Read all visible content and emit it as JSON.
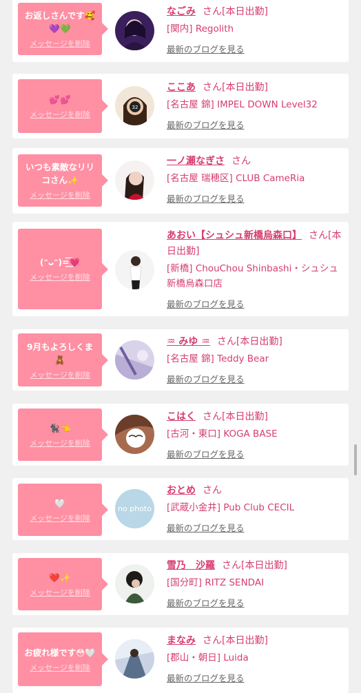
{
  "theme": {
    "accent": "#d63d6e",
    "bubble": "#ff8fa3",
    "background": "#f0f0f0"
  },
  "entries": [
    {
      "message": "お返しさんです🥰💜💚",
      "delete_label": "メッセージを削除",
      "name": "なごみ",
      "suffix": "さん[本日出勤]",
      "shop": "[関内] Regolith",
      "blog_label": "最新のブログを見る"
    },
    {
      "message": "💕💕",
      "delete_label": "メッセージを削除",
      "name": "ここあ",
      "suffix": "さん[本日出勤]",
      "shop": "[名古屋 錦] IMPEL DOWN Level32",
      "blog_label": "最新のブログを見る"
    },
    {
      "message": "いつも素敵なリリコさん✨",
      "delete_label": "メッセージを削除",
      "name": "一ノ瀬なぎさ",
      "suffix": "さん",
      "shop": "[名古屋 瑞穂区] CLUB CameRia",
      "blog_label": "最新のブログを見る"
    },
    {
      "message": "(ᵔᴗᵔ)=͟͟͞💗",
      "delete_label": "メッセージを削除",
      "name": "あおい【シュシュ新橋烏森口】",
      "suffix": "さん[本日出勤]",
      "shop": "[新橋] ChouChou Shinbashi・シュシュ新橋烏森口店",
      "blog_label": "最新のブログを見る"
    },
    {
      "message": "9月もよろしくま🧸",
      "delete_label": "メッセージを削除",
      "name": "♒︎ みゆ ♒︎",
      "suffix": "さん[本日出勤]",
      "shop": "[名古屋 錦] Teddy Bear",
      "blog_label": "最新のブログを見る"
    },
    {
      "message": "🐈‍⬛👈",
      "delete_label": "メッセージを削除",
      "name": "こはく",
      "suffix": "さん[本日出勤]",
      "shop": "[古河・東口] KOGA BASE",
      "blog_label": "最新のブログを見る"
    },
    {
      "message": "🤍",
      "delete_label": "メッセージを削除",
      "name": "おとめ",
      "suffix": "さん",
      "shop": "[武蔵小金井] Pub Club CECIL",
      "blog_label": "最新のブログを見る",
      "avatar_text": "no photo"
    },
    {
      "message": "❤️✨",
      "delete_label": "メッセージを削除",
      "name": "雪乃　沙羅",
      "suffix": "さん[本日出勤]",
      "shop": "[国分町] RITZ SENDAI",
      "blog_label": "最新のブログを見る"
    },
    {
      "message": "お疲れ様です😳🤍",
      "delete_label": "メッセージを削除",
      "name": "まなみ",
      "suffix": "さん[本日出勤]",
      "shop": "[郡山・朝日] Luida",
      "blog_label": "最新のブログを見る"
    }
  ]
}
